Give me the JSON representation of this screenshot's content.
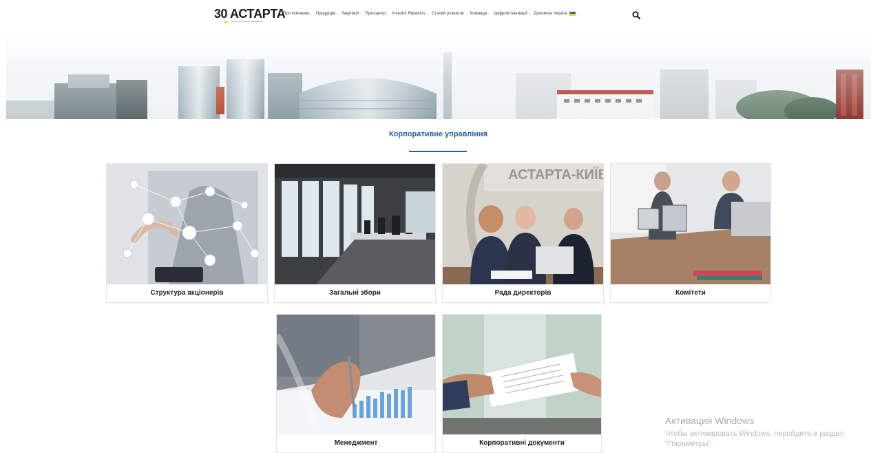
{
  "header": {
    "logo_number": "30",
    "logo_name": "АСТАРТА",
    "logo_tagline": "ефективне аграрне виробництво",
    "nav": [
      {
        "label": "Про компанію"
      },
      {
        "label": "Продукція"
      },
      {
        "label": "Закупівлі"
      },
      {
        "label": "Пресцентр"
      },
      {
        "label": "Investor Relations"
      },
      {
        "label": "Сталий розвиток"
      },
      {
        "label": "Команда"
      },
      {
        "label": "Цифрові інновації"
      },
      {
        "label": "Допомога Україні"
      }
    ],
    "language_flag": "ukraine-flag-icon",
    "search_icon": "search-icon"
  },
  "section": {
    "title": "Корпоративне управління",
    "accent_color": "#2c5e96"
  },
  "cards": [
    {
      "label": "Структура акціонерів",
      "image": "network-touch-photo"
    },
    {
      "label": "Загальні збори",
      "image": "meeting-room-photo"
    },
    {
      "label": "Рада директорів",
      "image": "board-members-photo"
    },
    {
      "label": "Комітети",
      "image": "team-discussion-photo"
    },
    {
      "label": "Менеджмент",
      "image": "chart-pen-photo"
    },
    {
      "label": "Корпоративні документи",
      "image": "document-handover-photo"
    }
  ],
  "hero_photo_text": "АСТАРТА-КИЇВ",
  "watermark": {
    "title": "Активация Windows",
    "subtitle": "Чтобы активировать Windows, перейдите в раздел \"Параметры\"."
  }
}
